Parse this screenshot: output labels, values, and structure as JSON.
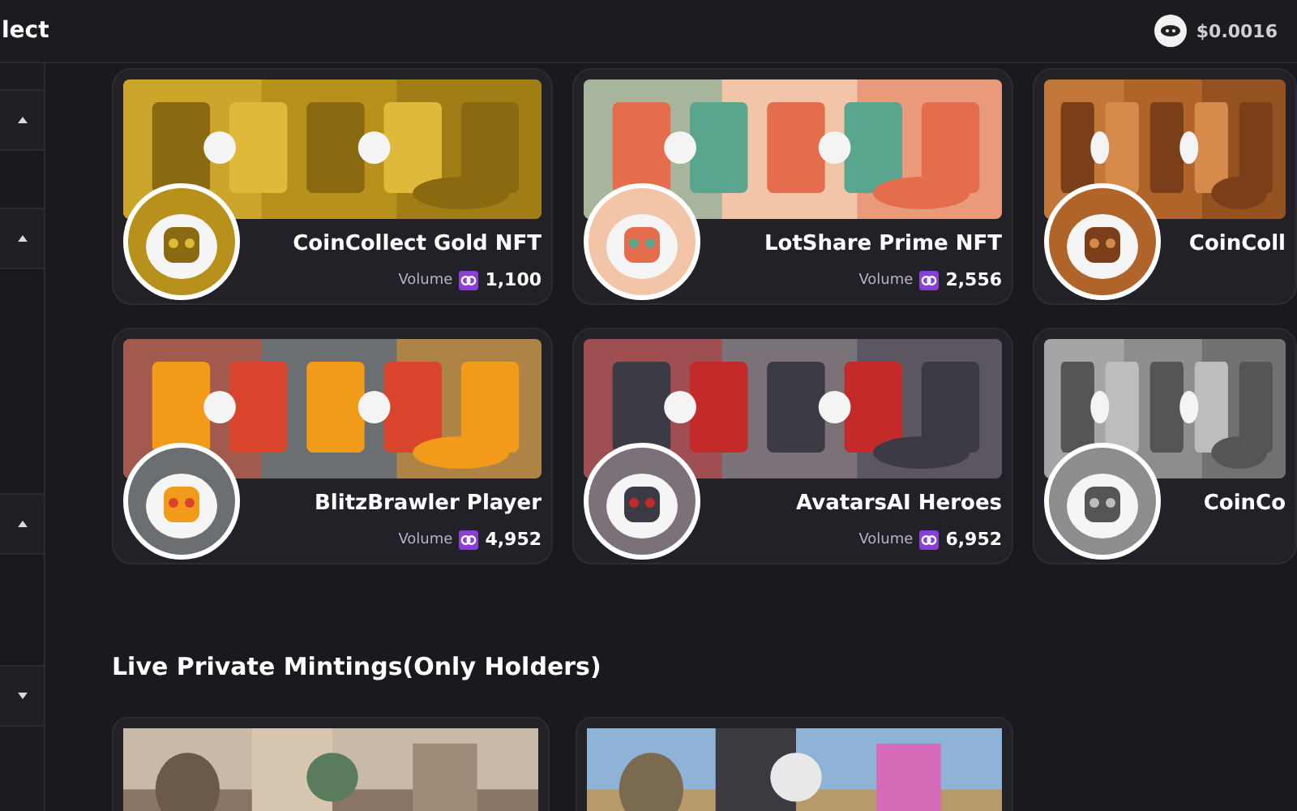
{
  "header": {
    "title": "lect",
    "price": "$0.0016"
  },
  "sidebar": {
    "groups": [
      {
        "expanded": true
      },
      {
        "expanded": true
      },
      {
        "expanded": true
      },
      {
        "expanded": false
      }
    ]
  },
  "collections": [
    {
      "name": "CoinCollect Gold NFT",
      "volume_label": "Volume",
      "volume": "1,100"
    },
    {
      "name": "LotShare Prime NFT",
      "volume_label": "Volume",
      "volume": "2,556"
    },
    {
      "name": "CoinColl"
    },
    {
      "name": "BlitzBrawler Player",
      "volume_label": "Volume",
      "volume": "4,952"
    },
    {
      "name": "AvatarsAI Heroes",
      "volume_label": "Volume",
      "volume": "6,952"
    },
    {
      "name": "CoinCo"
    }
  ],
  "mintings": {
    "title": "Live Private Mintings(Only Holders)"
  }
}
